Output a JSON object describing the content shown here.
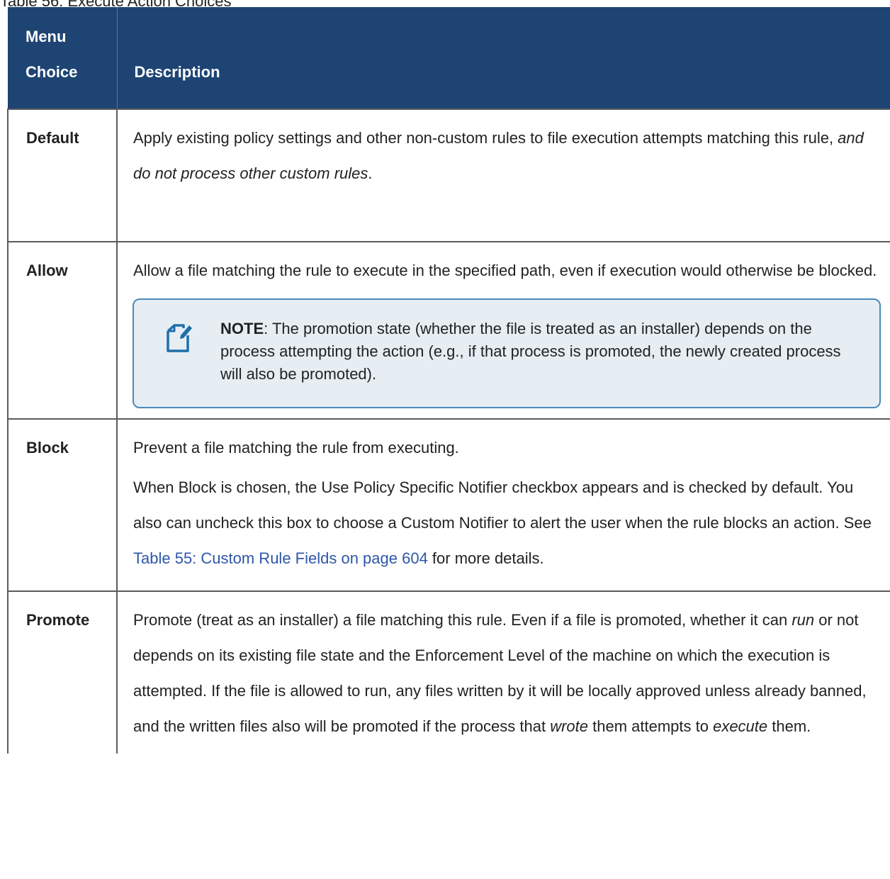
{
  "caption": "Table 56: Execute Action Choices",
  "headers": {
    "menu_choice": "Menu Choice",
    "menu_line1": "Menu",
    "menu_line2": "Choice",
    "description": "Description"
  },
  "rows": {
    "default": {
      "choice": "Default",
      "text_a": "Apply existing policy settings and other non-custom rules to file execution attempts matching this rule, ",
      "text_em": "and do not process other custom rules",
      "text_b": "."
    },
    "allow": {
      "choice": "Allow",
      "text": "Allow a file matching the rule to execute in the specified path, even if execution would otherwise be blocked.",
      "note_label": "NOTE",
      "note_text": ": The promotion state (whether the file is treated as an installer) depends on the process attempting the action (e.g., if that process is promoted, the newly created process will also be promoted)."
    },
    "block": {
      "choice": "Block",
      "text1": "Prevent a file matching the rule from executing.",
      "text2_a": "When Block is chosen, the Use Policy Specific Notifier checkbox appears and is checked by default. You also can uncheck this box to choose a Custom Notifier to alert the user when the rule blocks an action. See ",
      "link": "Table 55: Custom Rule Fields on page 604",
      "text2_b": " for more details."
    },
    "promote": {
      "choice": "Promote",
      "text_a": "Promote (treat as an installer) a file matching this rule. Even if a file is promoted, whether it can ",
      "em_run": "run",
      "text_b": " or not depends on its existing file state and the Enforcement Level of the machine on which the execution is attempted. If the file is allowed to run, any files written by it will be locally approved unless already banned, and the written files also will be promoted if the process that ",
      "em_wrote": "wrote",
      "text_c": " them attempts to ",
      "em_execute": "execute",
      "text_d": " them."
    }
  },
  "icons": {
    "note": "note-pencil-icon"
  },
  "colors": {
    "header_bg": "#1e4474",
    "note_bg": "#e6eef4",
    "note_border": "#4d89b8",
    "link": "#2e56a8"
  }
}
